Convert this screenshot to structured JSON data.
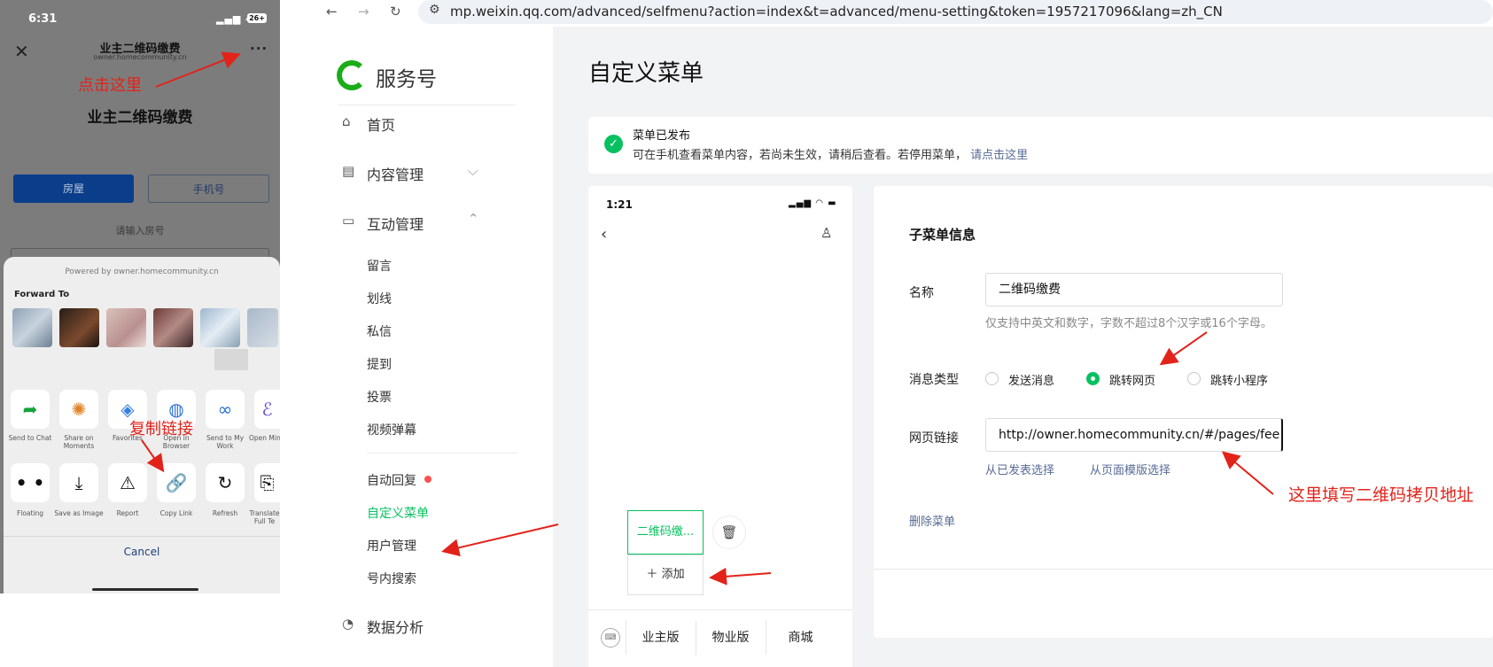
{
  "phone": {
    "status_time": "6:31",
    "status_network": "4G",
    "status_battery": "26+",
    "title": "业主二维码缴费",
    "subtitle": "owner.homecommunity.cn",
    "heading": "业主二维码缴费",
    "tab_house": "房屋",
    "tab_phone": "手机号",
    "room_hint": "请输入房号",
    "sheet": {
      "powered_by": "Powered by owner.homecommunity.cn",
      "forward_to": "Forward To",
      "actions_row1": [
        {
          "label": "Send to Chat",
          "icon": "share-arrow-icon"
        },
        {
          "label": "Share on Moments",
          "icon": "moments-icon"
        },
        {
          "label": "Favorites",
          "icon": "favorites-cube-icon"
        },
        {
          "label": "Open in Browser",
          "icon": "browser-globe-icon"
        },
        {
          "label": "Send to My Work",
          "icon": "work-icon"
        },
        {
          "label": "Open Mini Prog",
          "icon": "mini-program-icon"
        }
      ],
      "actions_row2": [
        {
          "label": "Floating",
          "icon": "floating-dots-icon"
        },
        {
          "label": "Save as Image",
          "icon": "download-icon"
        },
        {
          "label": "Report",
          "icon": "warning-icon"
        },
        {
          "label": "Copy Link",
          "icon": "link-icon"
        },
        {
          "label": "Refresh",
          "icon": "refresh-icon"
        },
        {
          "label": "Translate Full Te",
          "icon": "translate-icon"
        }
      ],
      "cancel": "Cancel"
    },
    "annotation_click_here": "点击这里",
    "annotation_copy_link": "复制链接"
  },
  "browser": {
    "url": "mp.weixin.qq.com/advanced/selfmenu?action=index&t=advanced/menu-setting&token=1957217096&lang=zh_CN"
  },
  "sidebar": {
    "brand": "服务号",
    "items": [
      {
        "label": "首页",
        "icon": "home-icon"
      },
      {
        "label": "内容管理",
        "icon": "document-icon",
        "chevron": "down"
      },
      {
        "label": "互动管理",
        "icon": "chat-icon",
        "chevron": "up"
      }
    ],
    "sub_interaction": [
      "留言",
      "划线",
      "私信",
      "提到",
      "投票",
      "视频弹幕"
    ],
    "sub_other": [
      "自动回复",
      "自定义菜单",
      "用户管理",
      "号内搜索"
    ],
    "cutoff_item": "数据分析"
  },
  "page": {
    "title": "自定义菜单",
    "notice_title": "菜单已发布",
    "notice_body": "可在手机查看菜单内容，若尚未生效，请稍后查看。若停用菜单，",
    "notice_link": "请点击这里"
  },
  "preview": {
    "time": "1:21",
    "submenu_item": "二维码缴...",
    "add_label": "添加",
    "tabs": [
      "业主版",
      "物业版",
      "商城"
    ]
  },
  "form": {
    "section_title": "子菜单信息",
    "name_label": "名称",
    "name_value": "二维码缴费",
    "name_hint": "仅支持中英文和数字，字数不超过8个汉字或16个字母。",
    "type_label": "消息类型",
    "type_options": [
      "发送消息",
      "跳转网页",
      "跳转小程序"
    ],
    "type_selected": "跳转网页",
    "url_label": "网页链接",
    "url_value": "http://owner.homecommunity.cn/#/pages/fee",
    "from_published": "从已发表选择",
    "from_template": "从页面模版选择",
    "delete_menu": "删除菜单",
    "annotation_fill_url": "这里填写二维码拷贝地址"
  },
  "colors": {
    "accent_green": "#07c160",
    "link_blue": "#576b95",
    "annotation_red": "#e2231a",
    "primary_tab_blue": "#0b3e8a"
  }
}
